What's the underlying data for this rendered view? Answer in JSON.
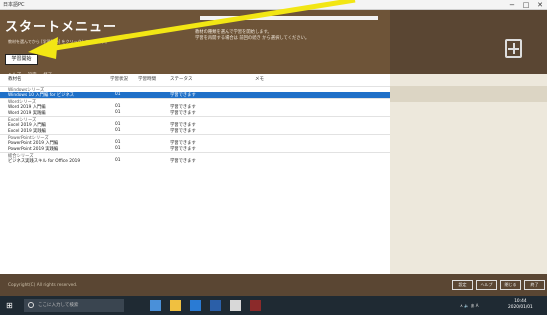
{
  "window": {
    "title": "日本語PC",
    "minimize": "−",
    "maximize": "□",
    "close": "✕"
  },
  "header": {
    "app_title": "スタートメニュー",
    "note": "教材を選んでから [学習開始] をクリックしてください。",
    "menu_button": "学習開始",
    "info_line1": "教材の種類を選んで学習を開始します。",
    "info_line2": "学習を再開する場合は 前回の続き から選択してください。",
    "links": "ヘルプ 　 設定 　 終了",
    "icon": "plus-box-icon",
    "accent_arrow": "#f2e614"
  },
  "table": {
    "columns": [
      "教材名",
      "学習状況",
      "学習時間",
      "ステータス",
      "メモ"
    ],
    "rows": [
      {
        "type": "group",
        "label": "Windowsシリーズ"
      },
      {
        "type": "item",
        "selected": true,
        "name": "Windows 10 入門編 for ビジネス",
        "c1": "01",
        "c2": "学習できます"
      },
      {
        "type": "group",
        "label": "Wordシリーズ"
      },
      {
        "type": "item",
        "name": "Word 2019 入門編",
        "c1": "01",
        "c2": "学習できます"
      },
      {
        "type": "item",
        "name": "Word 2019 実践編",
        "c1": "01",
        "c2": "学習できます"
      },
      {
        "type": "group",
        "label": "Excelシリーズ"
      },
      {
        "type": "item",
        "name": "Excel 2019 入門編",
        "c1": "01",
        "c2": "学習できます"
      },
      {
        "type": "item",
        "name": "Excel 2019 実践編",
        "c1": "01",
        "c2": "学習できます"
      },
      {
        "type": "group",
        "label": "PowerPointシリーズ"
      },
      {
        "type": "item",
        "name": "PowerPoint 2019 入門編",
        "c1": "01",
        "c2": "学習できます"
      },
      {
        "type": "item",
        "name": "PowerPoint 2019 実践編",
        "c1": "01",
        "c2": "学習できます"
      },
      {
        "type": "group",
        "label": "総合シリーズ"
      },
      {
        "type": "item",
        "name": "ビジネス実践スキル for Office 2019",
        "c1": "01",
        "c2": "学習できます"
      }
    ]
  },
  "footer": {
    "copyright": "Copyright(C) All rights reserved.",
    "buttons": [
      "設定",
      "ヘルプ",
      "閉じる",
      "終了"
    ]
  },
  "taskbar": {
    "search_placeholder": "ここに入力して検索",
    "time": "10:44",
    "date": "2020/01/01",
    "tray": "∧ 🔈 あ A"
  }
}
